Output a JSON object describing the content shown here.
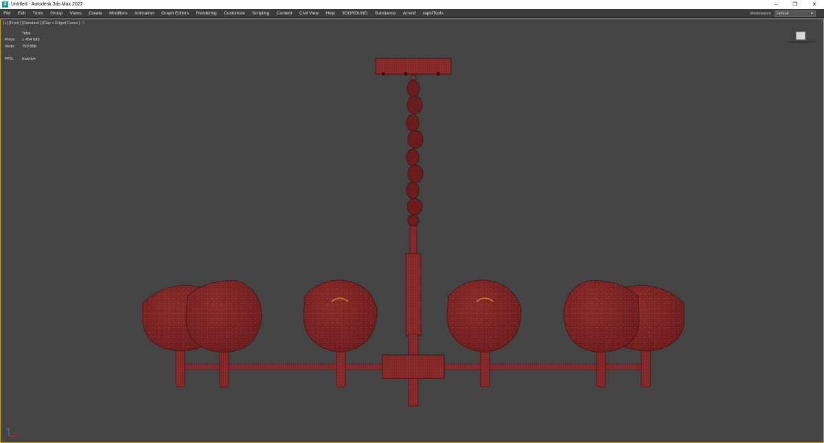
{
  "window": {
    "title": "Untitled - Autodesk 3ds Max 2022",
    "app_icon_glyph": "3",
    "minimize_glyph": "–",
    "restore_glyph": "❐",
    "close_glyph": "✕"
  },
  "menu": {
    "items": [
      "File",
      "Edit",
      "Tools",
      "Group",
      "Views",
      "Create",
      "Modifiers",
      "Animation",
      "Graph Editors",
      "Rendering",
      "Customize",
      "Scripting",
      "Content",
      "Civil View",
      "Help",
      "3DGROUND",
      "Substance",
      "Arnold",
      "rapidTools"
    ],
    "workspaces_label": "Workspaces:",
    "workspaces_value": "Default"
  },
  "viewport": {
    "label": "[+] [Front ] [Standard ] [Clay + Edged Faces ]",
    "filter_glyph": "⊽",
    "active_border_color": "#c9a400",
    "background_color": "#444444"
  },
  "stats": {
    "header": "Total",
    "polys_label": "Polys:",
    "polys_value": "1 454 682",
    "verts_label": "Verts:",
    "verts_value": "750 858",
    "fps_label": "FPS:",
    "fps_value": "Inactive"
  },
  "model": {
    "name": "chandelier",
    "clay_color": "#8b2a2a",
    "wire_color": "#5a1212"
  },
  "icons": {
    "viewcube": "viewcube-icon",
    "axis": "axis-gizmo-icon",
    "filter": "filter-icon"
  }
}
